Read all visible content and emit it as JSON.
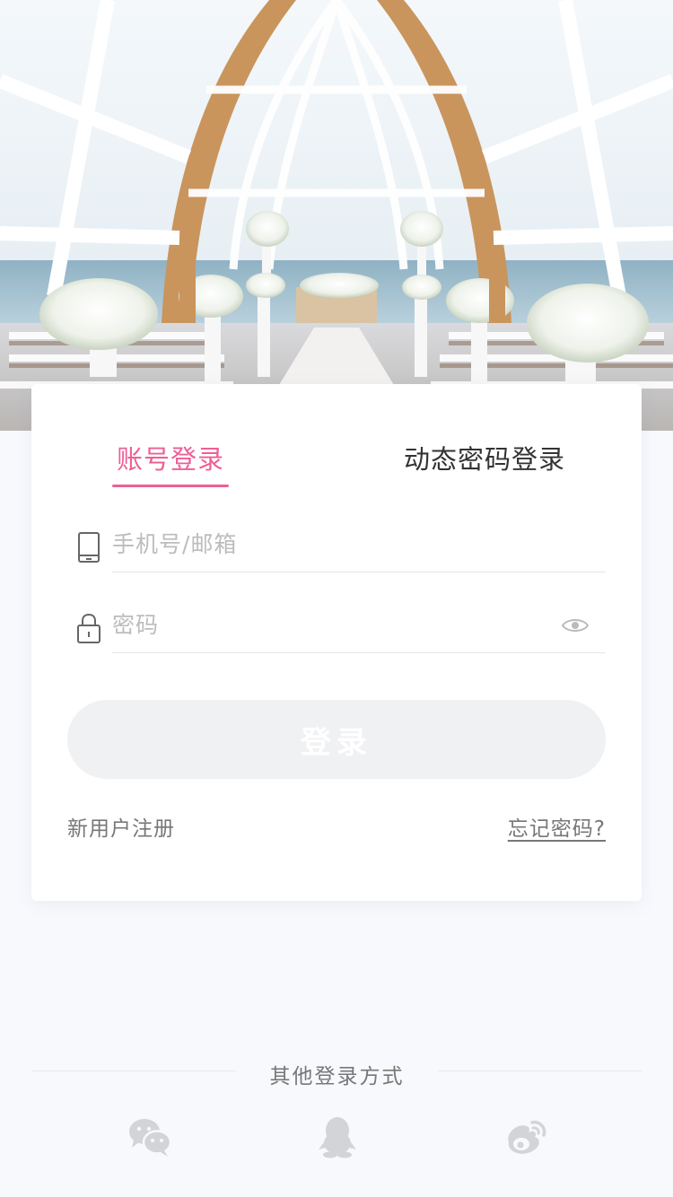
{
  "tabs": {
    "account_login": "账号登录",
    "dynamic_password_login": "动态密码登录",
    "active": "account_login"
  },
  "form": {
    "account_placeholder": "手机号/邮箱",
    "account_value": "",
    "password_placeholder": "密码",
    "password_value": ""
  },
  "actions": {
    "login_label": "登录",
    "register_label": "新用户注册",
    "forgot_label": "忘记密码?"
  },
  "other_login": {
    "title": "其他登录方式",
    "methods": [
      {
        "icon": "wechat-icon"
      },
      {
        "icon": "qq-icon"
      },
      {
        "icon": "weibo-icon"
      }
    ]
  },
  "colors": {
    "accent": "#ee5f95",
    "button_disabled": "#f0f1f3",
    "background": "#f8f9fd"
  },
  "icons": {
    "account_field": "phone-icon",
    "password_field": "lock-icon",
    "password_toggle": "eye-icon"
  }
}
